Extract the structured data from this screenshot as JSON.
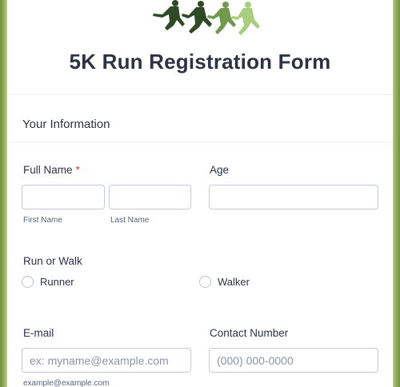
{
  "form": {
    "title": "5K Run Registration Form",
    "section_title": "Your Information",
    "full_name": {
      "label": "Full Name",
      "required_mark": "*",
      "first_sublabel": "First Name",
      "last_sublabel": "Last Name",
      "first_value": "",
      "last_value": ""
    },
    "age": {
      "label": "Age",
      "value": ""
    },
    "run_or_walk": {
      "label": "Run or Walk",
      "options": [
        "Runner",
        "Walker"
      ]
    },
    "email": {
      "label": "E-mail",
      "placeholder": "ex: myname@example.com",
      "sublabel": "example@example.com"
    },
    "contact": {
      "label": "Contact Number",
      "placeholder": "(000) 000-0000"
    }
  },
  "colors": {
    "background_edge": "#6f8f3f",
    "runner_dark": "#2f4a25",
    "runner_mid": "#6f9a4c",
    "runner_light": "#a8cf7e",
    "title_text": "#2c3345",
    "required": "#d0403a"
  }
}
